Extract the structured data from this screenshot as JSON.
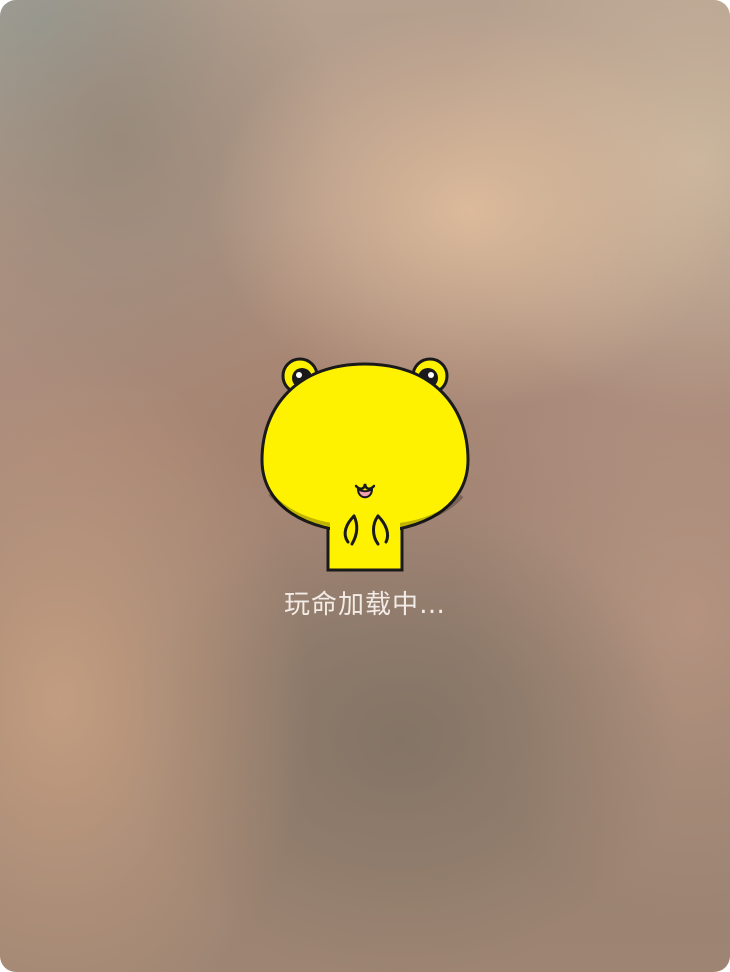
{
  "loading": {
    "text": "玩命加载中…",
    "mascot_icon": "yellow-bear-mascot-icon"
  },
  "colors": {
    "mascot_fill": "#FFF200",
    "outline": "#1A1A1A",
    "text": "#F3ECE6"
  }
}
